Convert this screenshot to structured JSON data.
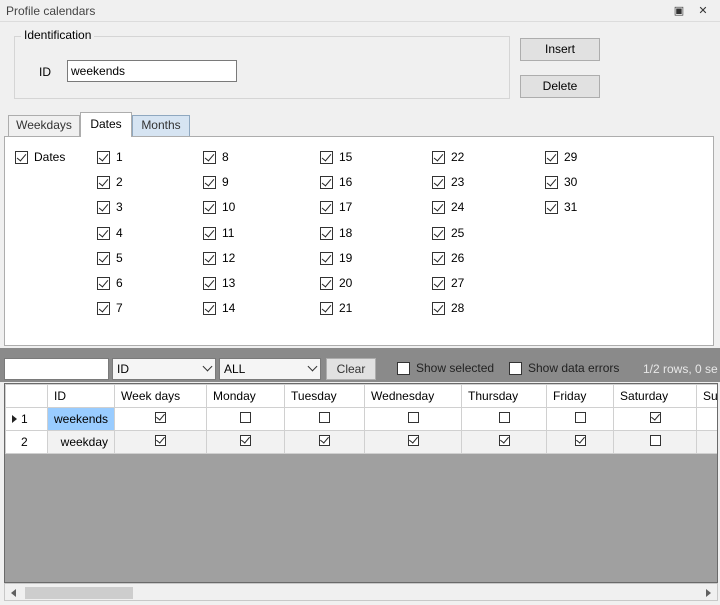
{
  "window": {
    "title": "Profile calendars"
  },
  "identification": {
    "legend": "Identification",
    "id_label": "ID",
    "id_value": "weekends",
    "insert_label": "Insert",
    "delete_label": "Delete"
  },
  "tabs": [
    {
      "label": "Weekdays",
      "active": false
    },
    {
      "label": "Dates",
      "active": true
    },
    {
      "label": "Months",
      "active": false
    }
  ],
  "dates_panel": {
    "master_label": "Dates",
    "master_checked": true,
    "columns": [
      [
        "1",
        "2",
        "3",
        "4",
        "5",
        "6",
        "7"
      ],
      [
        "8",
        "9",
        "10",
        "11",
        "12",
        "13",
        "14"
      ],
      [
        "15",
        "16",
        "17",
        "18",
        "19",
        "20",
        "21"
      ],
      [
        "22",
        "23",
        "24",
        "25",
        "26",
        "27",
        "28"
      ],
      [
        "29",
        "30",
        "31"
      ]
    ],
    "all_checked": true
  },
  "toolbar": {
    "filter_value": "",
    "column_select": "ID",
    "value_select": "ALL",
    "clear_label": "Clear",
    "show_selected_label": "Show selected",
    "show_errors_label": "Show data errors",
    "rows_info": "1/2 rows, 0 se"
  },
  "grid": {
    "headers": [
      "",
      "ID",
      "Week days",
      "Monday",
      "Tuesday",
      "Wednesday",
      "Thursday",
      "Friday",
      "Saturday",
      "Sur"
    ],
    "rows": [
      {
        "num": "1",
        "current": true,
        "id": "weekends",
        "checks": [
          true,
          false,
          false,
          false,
          false,
          false,
          true
        ]
      },
      {
        "num": "2",
        "current": false,
        "id": "weekday",
        "checks": [
          true,
          true,
          true,
          true,
          true,
          true,
          false
        ]
      }
    ]
  }
}
